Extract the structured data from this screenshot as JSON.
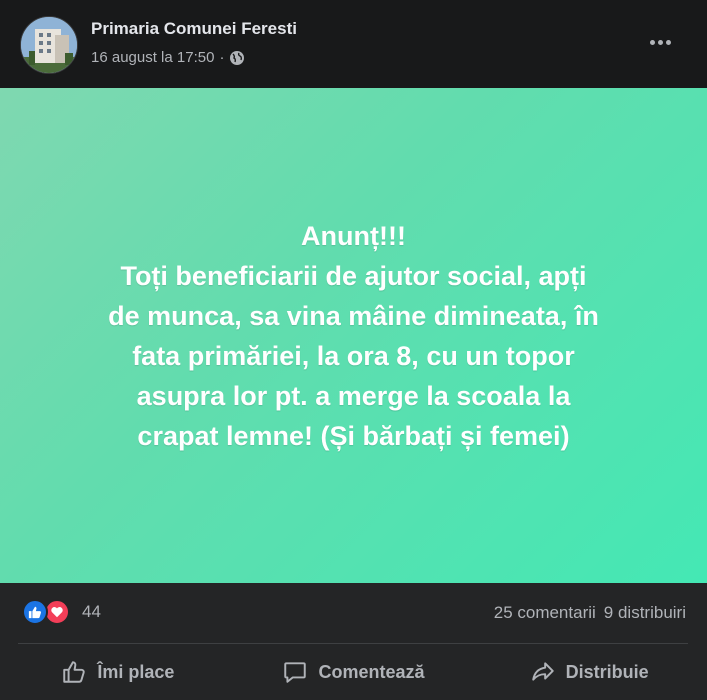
{
  "post": {
    "page_name": "Primaria Comunei Feresti",
    "date": "16 august la 17:50",
    "separator": "·",
    "privacy_icon": "globe-icon",
    "more_icon": "more-options-icon",
    "content_lines": [
      "Anunț!!!",
      "Toți beneficiarii de ajutor social, apți",
      "de munca, sa vina mâine dimineata, în",
      "fata primăriei, la ora 8, cu un topor",
      "asupra lor pt. a merge la scoala la",
      "crapat lemne! (Și bărbați și femei)"
    ],
    "background_colors": [
      "#7fd8b0",
      "#44e8b4"
    ]
  },
  "stats": {
    "reactions": [
      "like-icon",
      "love-icon"
    ],
    "reaction_count": "44",
    "comments": "25 comentarii",
    "shares": "9 distribuiri"
  },
  "actions": {
    "like_label": "Îmi place",
    "comment_label": "Comentează",
    "share_label": "Distribuie"
  },
  "colors": {
    "like_blue": "#1b74e4",
    "love_red": "#f33e58",
    "secondary_text": "#b0b3b8"
  }
}
